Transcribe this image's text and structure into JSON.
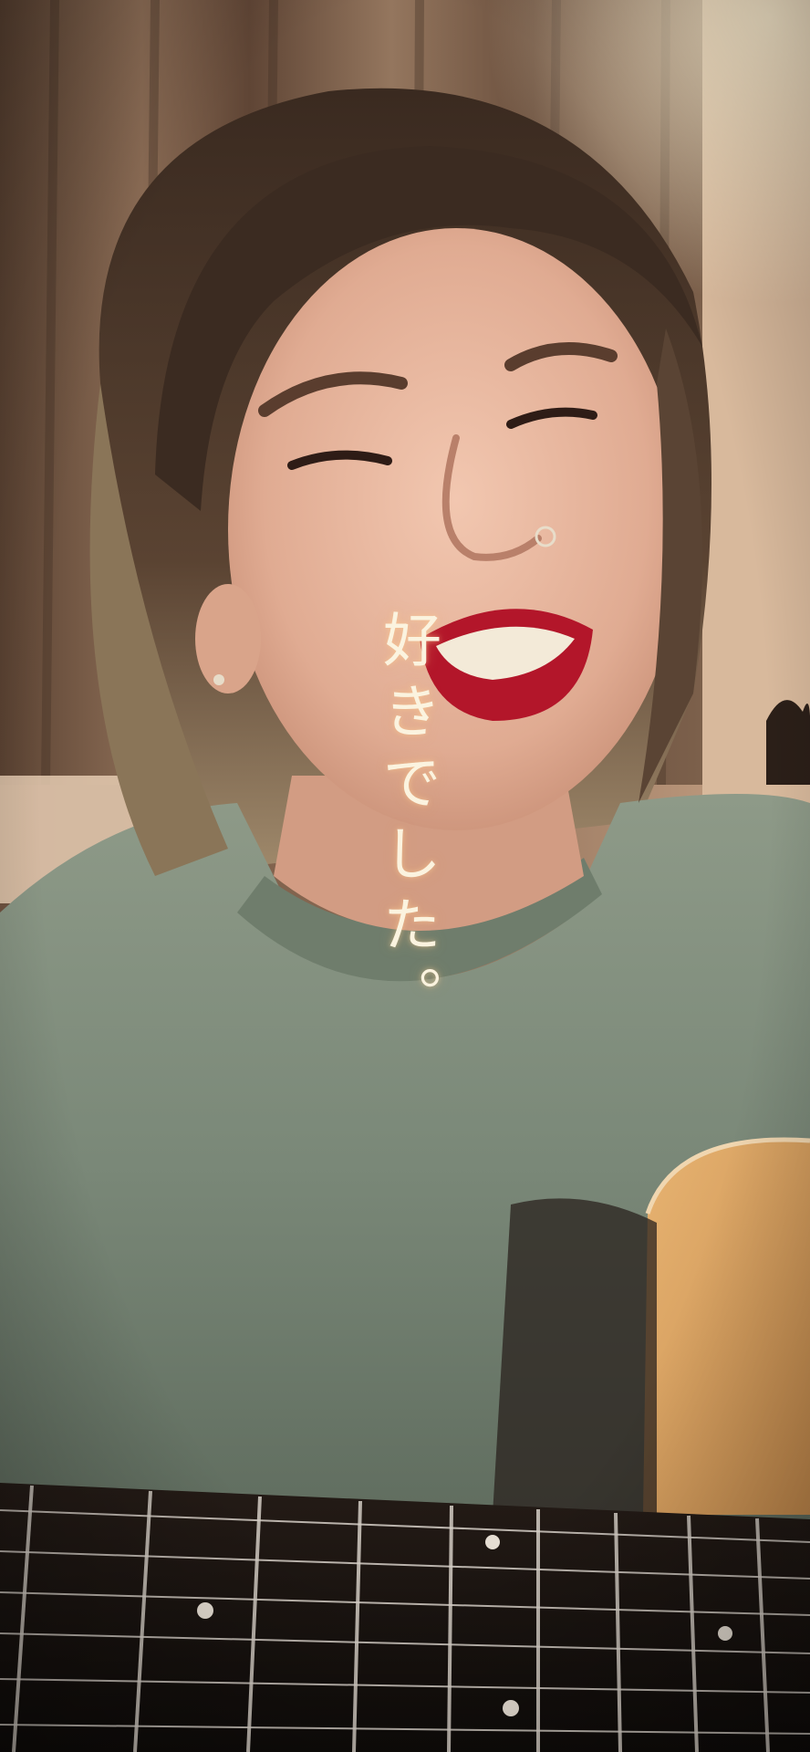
{
  "lyric_caption": "好きでした。",
  "palette": {
    "lyric_text": "#fbf3df",
    "curtain": "#8a6a52",
    "wall": "#d9b89a",
    "hair": "#4a3426",
    "skin": "#e6b59c",
    "lips": "#c0182a",
    "sweatshirt": "#7f8d7e",
    "guitar_top": "#d9a15e",
    "fretboard": "#15110f"
  }
}
